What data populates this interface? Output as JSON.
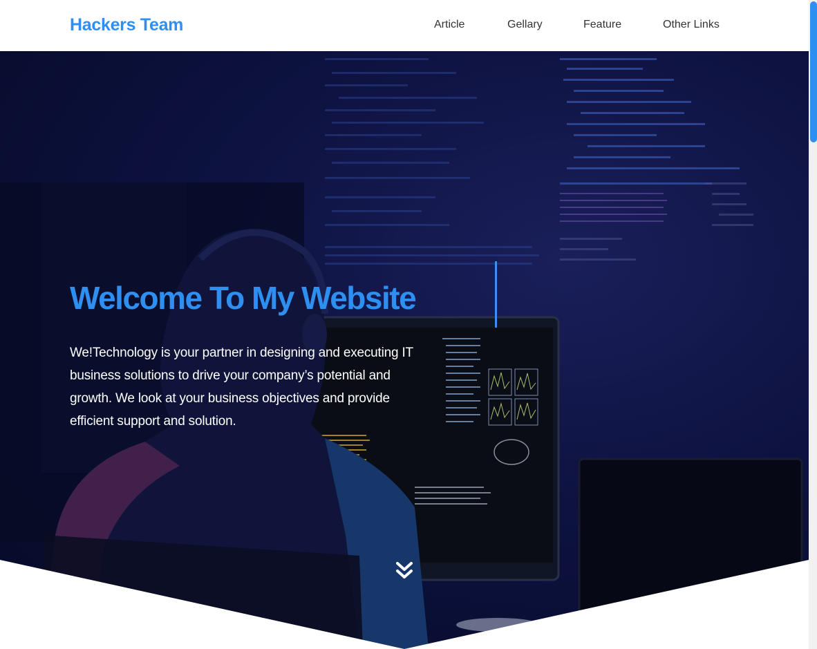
{
  "header": {
    "brand": "Hackers Team",
    "nav": [
      "Article",
      "Gellary",
      "Feature",
      "Other Links"
    ]
  },
  "hero": {
    "title": "Welcome To My Website",
    "description": "We!Technology is your partner in designing and executing IT business solutions to drive your company’s potential and growth. We look at your business objectives and provide efficient support and solution."
  },
  "icons": {
    "scroll_down": "double-chevron-down-icon"
  },
  "colors": {
    "accent": "#2f8ff0",
    "hero_bg": "#0d1240",
    "text_light": "#ffffff"
  }
}
